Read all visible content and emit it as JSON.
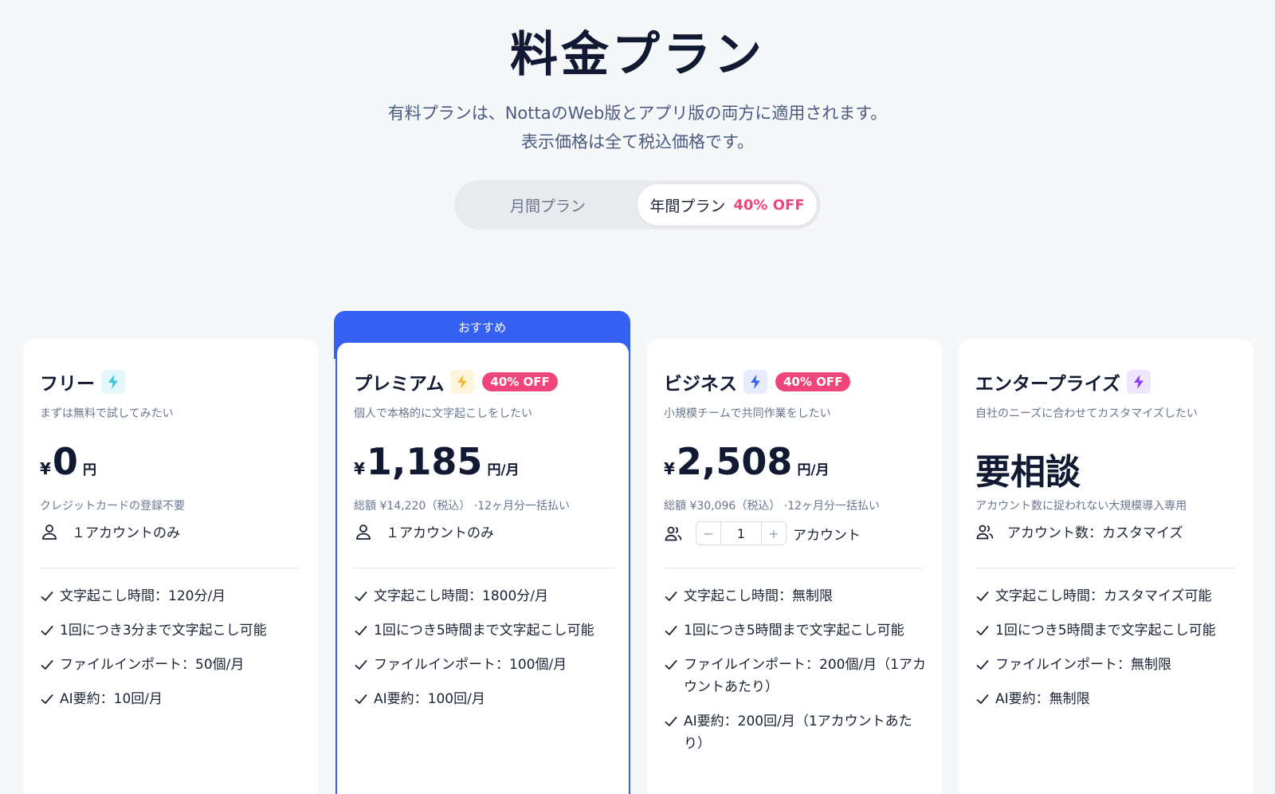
{
  "header": {
    "title": "料金プラン",
    "subtitle_line1": "有料プランは、NottaのWeb版とアプリ版の両方に適用されます。",
    "subtitle_line2": "表示価格は全て税込価格です。"
  },
  "billing_toggle": {
    "monthly_label": "月間プラン",
    "yearly_label": "年間プラン",
    "yearly_discount": "40% OFF",
    "selected": "yearly"
  },
  "recommended_label": "おすすめ",
  "colors": {
    "accent_blue": "#3661f0",
    "discount_pink": "#f0457a"
  },
  "plans": [
    {
      "name": "フリー",
      "icon": "bolt-icon",
      "description": "まずは無料で試してみたい",
      "currency": "¥",
      "price": "0",
      "unit": "円",
      "price_note": "クレジットカードの登録不要",
      "account": "１アカウントのみ",
      "features": [
        "文字起こし時間：120分/月",
        "1回につき3分まで文字起こし可能",
        "ファイルインポート：50個/月",
        "AI要約：10回/月"
      ]
    },
    {
      "name": "プレミアム",
      "icon": "bolt-icon",
      "badge": "40% OFF",
      "description": "個人で本格的に文字起こしをしたい",
      "currency": "¥",
      "price": "1,185",
      "unit": "円/月",
      "price_note": "総額 ¥14,220（税込） ·12ヶ月分一括払い",
      "account": "１アカウントのみ",
      "features": [
        "文字起こし時間：1800分/月",
        "1回につき5時間まで文字起こし可能",
        "ファイルインポート：100個/月",
        "AI要約：100回/月"
      ]
    },
    {
      "name": "ビジネス",
      "icon": "bolt-icon",
      "badge": "40% OFF",
      "description": "小規模チームで共同作業をしたい",
      "currency": "¥",
      "price": "2,508",
      "unit": "円/月",
      "price_note": "総額 ¥30,096（税込） ·12ヶ月分一括払い",
      "stepper_minus": "−",
      "stepper_value": "1",
      "stepper_plus": "+",
      "account": "アカウント",
      "features": [
        "文字起こし時間：無制限",
        "1回につき5時間まで文字起こし可能",
        "ファイルインポート：200個/月（1アカウントあたり）",
        "AI要約：200回/月（1アカウントあたり）"
      ]
    },
    {
      "name": "エンタープライズ",
      "icon": "bolt-icon",
      "description": "自社のニーズに合わせてカスタマイズしたい",
      "price": "要相談",
      "price_note": "アカウント数に捉われない大規模導入専用",
      "account": "アカウント数：カスタマイズ",
      "features": [
        "文字起こし時間：カスタマイズ可能",
        "1回につき5時間まで文字起こし可能",
        "ファイルインポート：無制限",
        "AI要約：無制限"
      ]
    }
  ]
}
